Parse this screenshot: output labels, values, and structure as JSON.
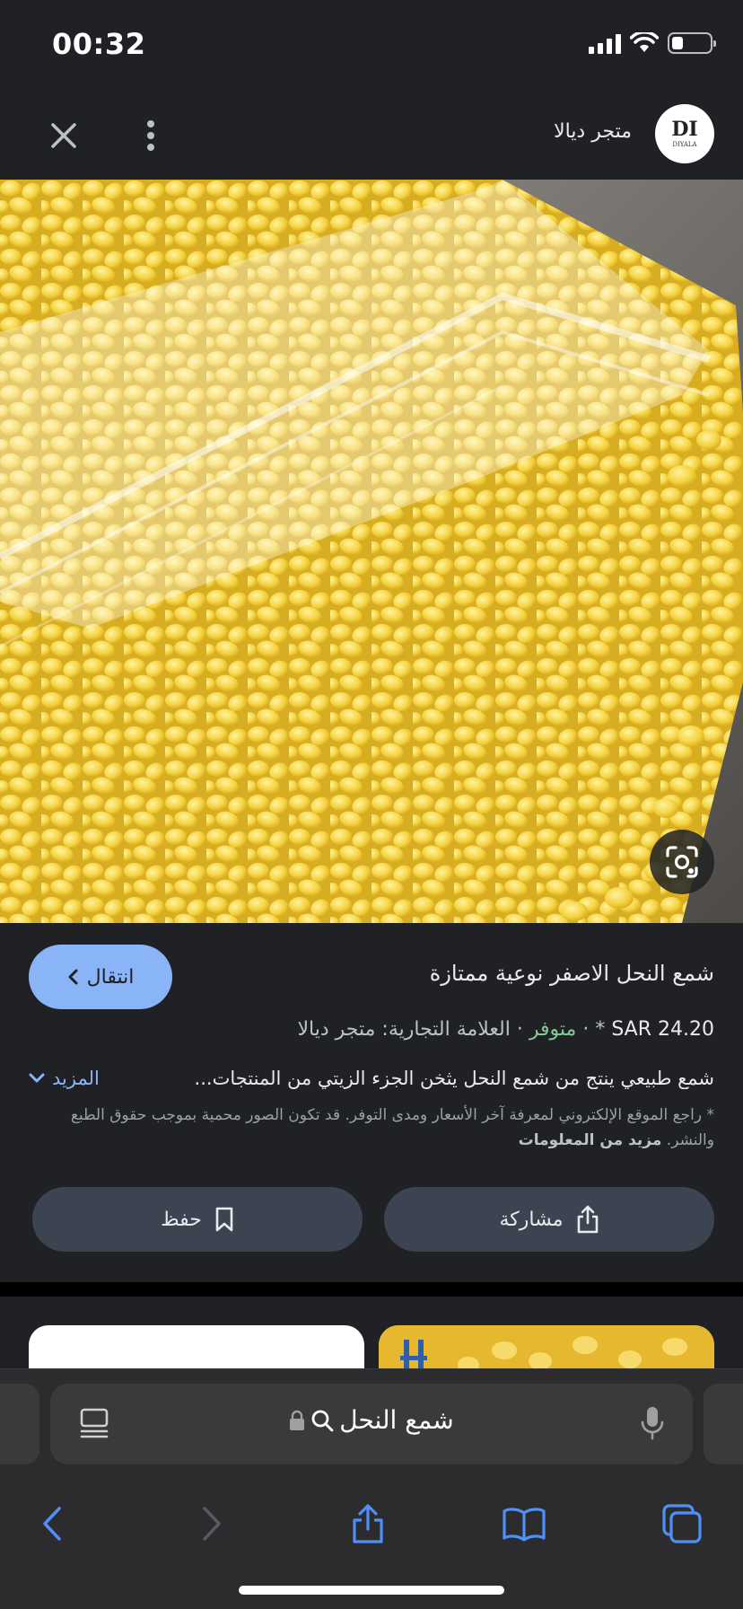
{
  "status_bar": {
    "time": "00:32",
    "battery_level": 0.3
  },
  "header": {
    "store_name": "متجر ديالا",
    "logo_monogram": "DI",
    "logo_text": "DIYALA",
    "icons": [
      "close-icon",
      "more-vert-icon"
    ]
  },
  "product": {
    "title": "شمع النحل الاصفر نوعية ممتازة",
    "go_label": "انتقال",
    "price": "SAR 24.20",
    "price_marker": "*",
    "separator": "·",
    "stock": "متوفر",
    "brand": "العلامة التجارية: متجر ديالا",
    "description": "شمع طبيعي ينتج من شمع النحل يثخن الجزء الزيتي من المنتجات...",
    "more_label": "المزيد",
    "disclaimer": "* راجع الموقع الإلكتروني لمعرفة آخر الأسعار ومدى التوفر. قد تكون الصور محمية بموجب حقوق الطبع والنشر.",
    "more_info_label": "مزيد من المعلومات",
    "share_label": "مشاركة",
    "save_label": "حفظ"
  },
  "browser": {
    "url_text": "شمع النحل",
    "icons": [
      "reader-icon",
      "lock-icon",
      "search-icon",
      "mic-icon",
      "back-icon",
      "forward-icon",
      "share-icon",
      "bookmarks-icon",
      "tabs-icon"
    ]
  },
  "colors": {
    "background": "#202124",
    "accent": "#8ab4f8",
    "stock_green": "#81c995",
    "button_bg": "#3c4452"
  }
}
